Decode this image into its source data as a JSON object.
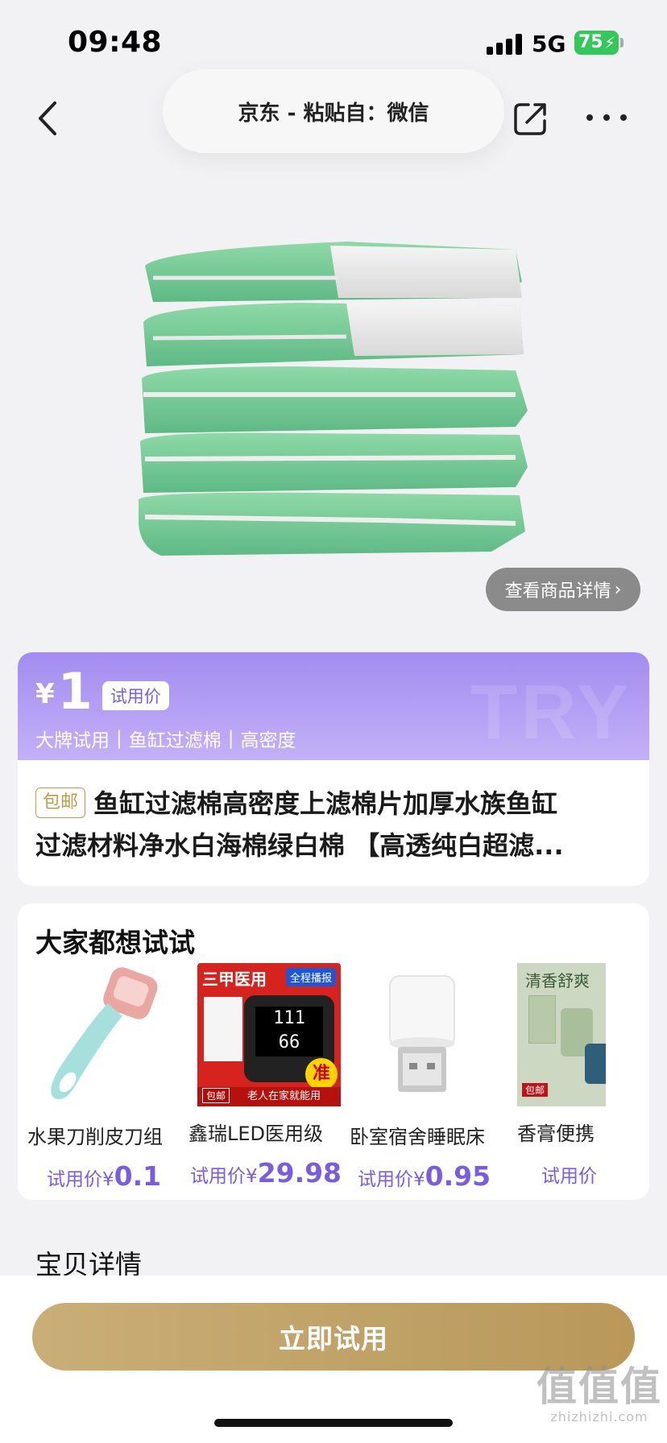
{
  "status_bar": {
    "time": "09:48",
    "network": "5G",
    "battery": "75"
  },
  "nav": {
    "title": "京东 - 粘贴自：微信",
    "back_icon": "chevron-left-icon",
    "share_icon": "share-icon",
    "more_icon": "more-icon"
  },
  "product": {
    "image": "green-white-filter-pads-stack",
    "view_detail_label": "查看商品详情",
    "currency": "¥",
    "price": "1",
    "price_tag": "试用价",
    "watermark": "TRY",
    "tags": [
      "大牌试用",
      "鱼缸过滤棉",
      "高密度"
    ],
    "free_shipping_badge": "包邮",
    "title_line1": "鱼缸过滤棉高密度上滤棉片加厚水族鱼缸",
    "title_line2": "过滤材料净水白海棉绿白棉 【高透纯白超滤..."
  },
  "recommendations": {
    "title": "大家都想试试",
    "items": [
      {
        "name": "水果刀削皮刀组",
        "price_label": "试用价¥",
        "price": "0.1",
        "thumb": "peeler"
      },
      {
        "name": "鑫瑞LED医用级",
        "price_label": "试用价¥",
        "price": "29.98",
        "thumb": "blood-pressure-monitor",
        "thumb_text": {
          "headline": "三甲医用",
          "badge": "全程播报",
          "mark": "准",
          "footer": "老人在家就能用",
          "ship": "包邮",
          "reading": "111\n66"
        }
      },
      {
        "name": "卧室宿舍睡眠床",
        "price_label": "试用价¥",
        "price": "0.95",
        "thumb": "usb-night-light"
      },
      {
        "name": "香膏便携",
        "price_label": "试用价",
        "price": "",
        "thumb": "cream",
        "thumb_text": {
          "headline": "清香舒爽",
          "ship": "包邮"
        }
      }
    ]
  },
  "details_section": {
    "title": "宝贝详情"
  },
  "action": {
    "try_button": "立即试用"
  },
  "watermark": {
    "logo": "值值值",
    "url": "zhizhizhi.com"
  },
  "colors": {
    "accent_purple": "#7a5ce0",
    "gold_button": "#c0a064",
    "battery_green": "#34c759"
  }
}
